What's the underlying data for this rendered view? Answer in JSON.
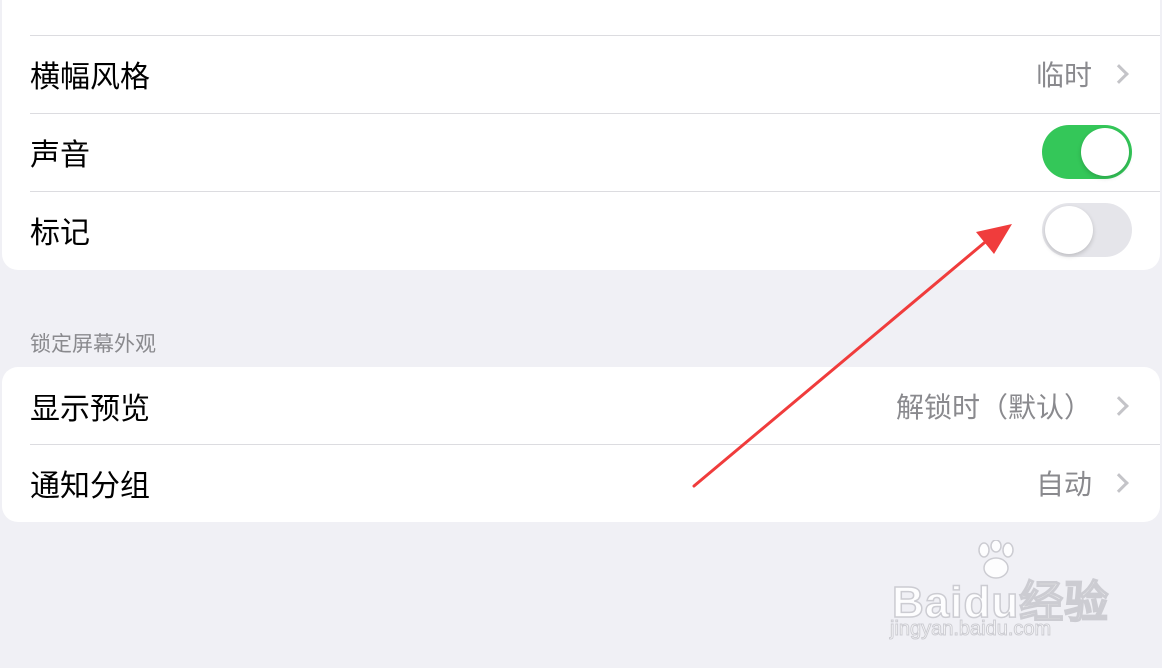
{
  "notification_style": {
    "rows": [
      {
        "label": "横幅风格",
        "value": "临时"
      },
      {
        "label": "声音",
        "toggle": true
      },
      {
        "label": "标记",
        "toggle": false
      }
    ]
  },
  "lock_screen": {
    "header": "锁定屏幕外观",
    "rows": [
      {
        "label": "显示预览",
        "value": "解锁时（默认）"
      },
      {
        "label": "通知分组",
        "value": "自动"
      }
    ]
  },
  "colors": {
    "toggle_on": "#34c759",
    "toggle_off": "#e5e5ea",
    "radio_selected": "#1477f8",
    "annotation_arrow": "#f03c3c"
  },
  "watermark": {
    "logo": "Baidu经验",
    "url": "jingyan.baidu.com"
  }
}
